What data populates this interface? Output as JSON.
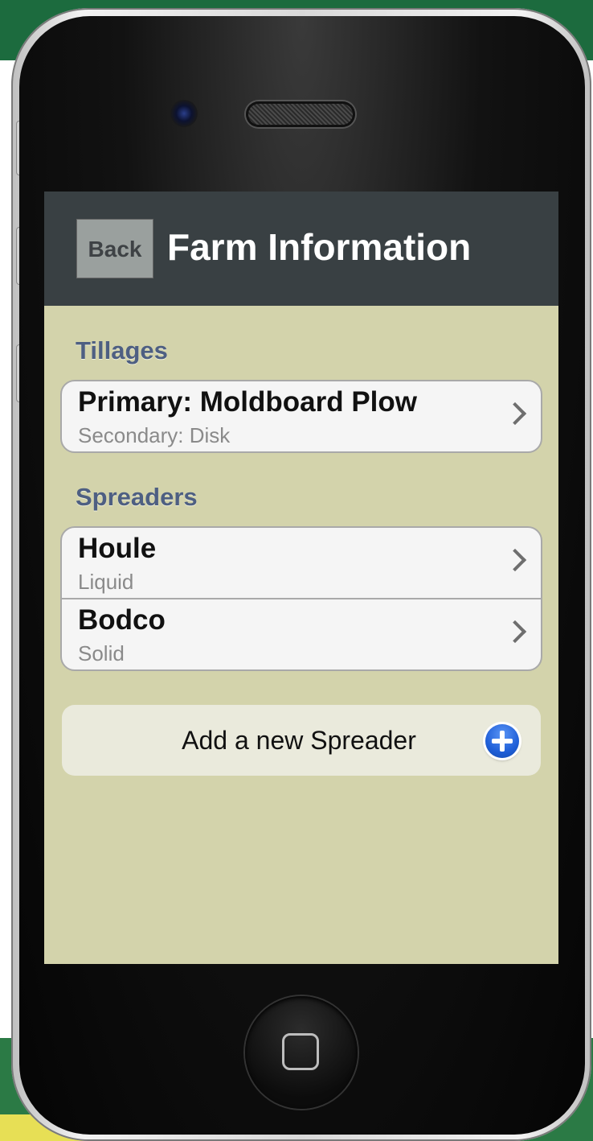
{
  "navbar": {
    "back_label": "Back",
    "title": "Farm Information"
  },
  "sections": {
    "tillages": {
      "header": "Tillages",
      "items": [
        {
          "title": "Primary: Moldboard Plow",
          "subtitle": "Secondary: Disk"
        }
      ]
    },
    "spreaders": {
      "header": "Spreaders",
      "items": [
        {
          "title": "Houle",
          "subtitle": "Liquid"
        },
        {
          "title": "Bodco",
          "subtitle": "Solid"
        }
      ]
    }
  },
  "add_spreader": {
    "label": "Add a new Spreader",
    "icon": "plus-circle-icon"
  },
  "colors": {
    "navbar": "#394043",
    "background": "#d3d3ab",
    "section_header": "#4e5f82",
    "accent_blue": "#1f5fd8"
  }
}
